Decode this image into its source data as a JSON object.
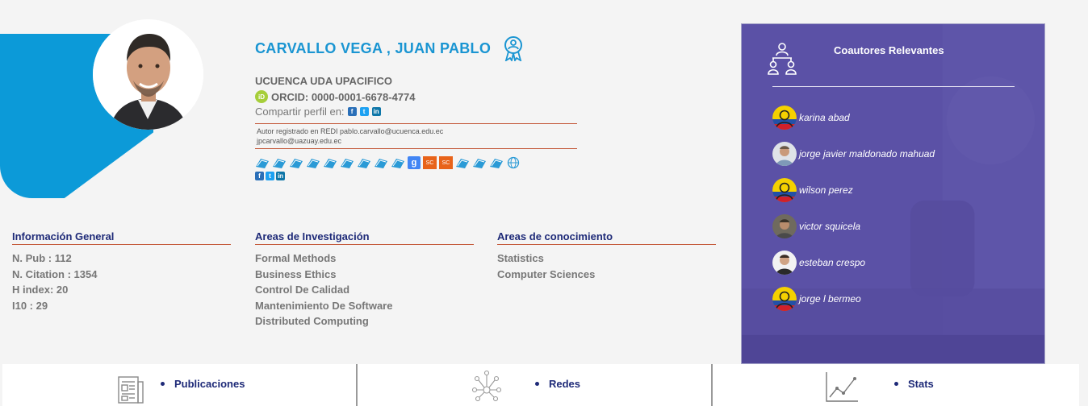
{
  "profile": {
    "name": "CARVALLO VEGA , JUAN PABLO",
    "institution": "UCUENCA UDA UPACIFICO",
    "orcid_label": "ORCID: 0000-0001-6678-4774",
    "share_label": "Compartir perfil en:",
    "registered_line1": "Autor registrado en REDI pablo.carvallo@ucuenca.edu.ec",
    "registered_line2": "jpcarvallo@uazuay.edu.ec"
  },
  "icons": {
    "orcid": "iD",
    "facebook": "f",
    "twitter": "t",
    "linkedin": "in",
    "google_scholar": "g",
    "scopus": "SC"
  },
  "info_general": {
    "title": "Información General",
    "items": [
      "N. Pub : 112",
      "N. Citation : 1354",
      "H index: 20",
      "I10 : 29"
    ]
  },
  "research_areas": {
    "title": "Areas de Investigación",
    "items": [
      "Formal Methods",
      "Business Ethics",
      "Control De Calidad",
      "Mantenimiento De Software",
      "Distributed Computing"
    ]
  },
  "knowledge_areas": {
    "title": "Areas de conocimiento",
    "items": [
      "Statistics",
      "Computer Sciences"
    ]
  },
  "coauthors": {
    "title": "Coautores Relevantes",
    "items": [
      {
        "name": "karina abad",
        "avatar": "default-flag"
      },
      {
        "name": "jorge javier maldonado mahuad",
        "avatar": "photo"
      },
      {
        "name": "wilson perez",
        "avatar": "default-flag"
      },
      {
        "name": "victor squicela",
        "avatar": "photo"
      },
      {
        "name": "esteban crespo",
        "avatar": "photo"
      },
      {
        "name": "jorge l bermeo",
        "avatar": "default-flag"
      }
    ]
  },
  "tabs": [
    {
      "label": "Publicaciones",
      "icon": "publications-icon"
    },
    {
      "label": "Redes",
      "icon": "network-icon"
    },
    {
      "label": "Stats",
      "icon": "stats-icon"
    }
  ],
  "colors": {
    "accent_blue": "#1a95d2",
    "navy": "#1e2a78",
    "divider": "#c4593a",
    "panel": "#5b51a6"
  }
}
